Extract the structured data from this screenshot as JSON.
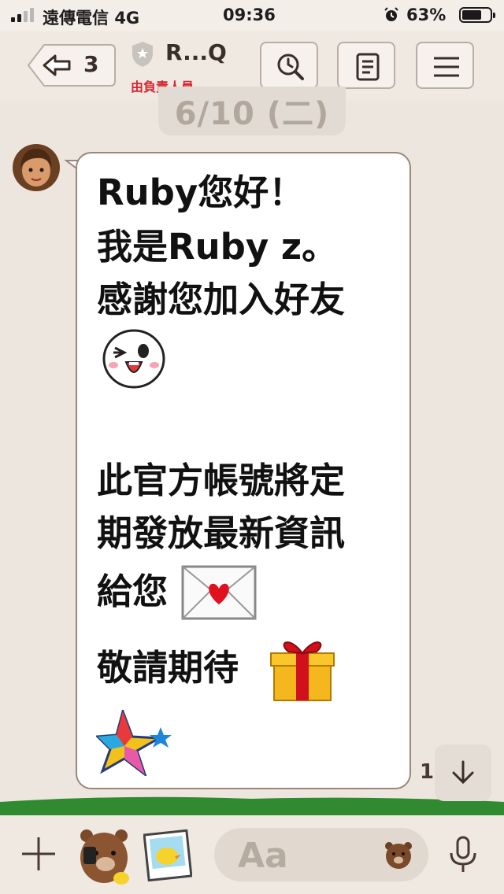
{
  "status_bar": {
    "carrier": "遠傳電信",
    "network": "4G",
    "time": "09:36",
    "battery": "63%",
    "battery_level": 0.63
  },
  "header": {
    "back_count": "3",
    "title": "R...Q",
    "subtitle": "由負責人員...",
    "accent_red": "#d9232f"
  },
  "chat": {
    "date_label": "6/10 (二)",
    "time_peek": "1(",
    "message_lines": [
      "Ruby您好！",
      "我是Ruby z。",
      "感謝您加入好友",
      "此官方帳號將定",
      "期發放最新資訊",
      "給您",
      "敬請期待"
    ],
    "emoji_icons": [
      "wink-face-icon",
      "love-letter-icon",
      "gift-icon",
      "star-sparkle-icon"
    ]
  },
  "composer": {
    "placeholder": "Aa"
  },
  "colors": {
    "background": "#ede6df",
    "bubble_border": "#9c857b",
    "header_bg": "#efe9e2"
  }
}
